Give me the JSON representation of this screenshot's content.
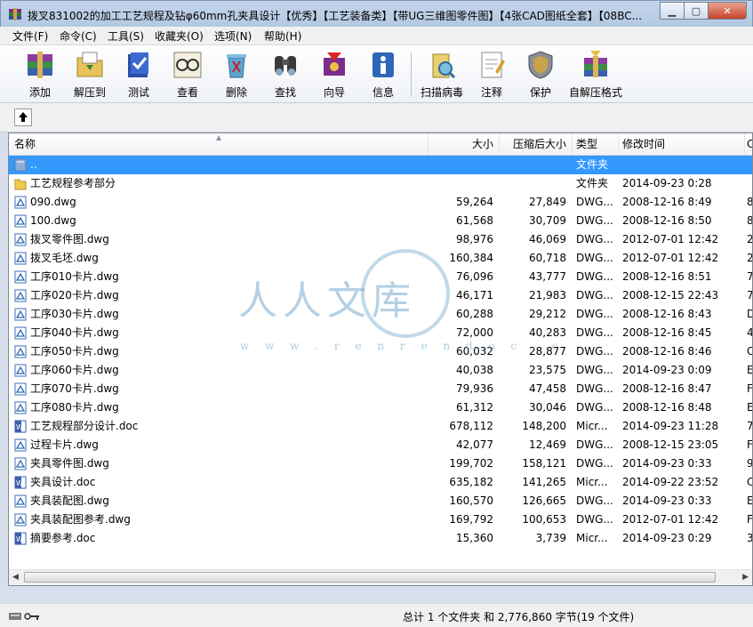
{
  "window": {
    "title": "拨叉831002的加工工艺规程及钻φ60mm孔夹具设计【优秀】【工艺装备类】【带UG三维图零件图】【4张CAD图纸全套】【08BC..."
  },
  "menu": [
    "文件(F)",
    "命令(C)",
    "工具(S)",
    "收藏夹(O)",
    "选项(N)",
    "帮助(H)"
  ],
  "toolbar": [
    {
      "label": "添加",
      "icon": "add-archive-icon"
    },
    {
      "label": "解压到",
      "icon": "extract-to-icon"
    },
    {
      "label": "测试",
      "icon": "test-icon"
    },
    {
      "label": "查看",
      "icon": "view-icon"
    },
    {
      "label": "删除",
      "icon": "delete-icon"
    },
    {
      "label": "查找",
      "icon": "find-icon"
    },
    {
      "label": "向导",
      "icon": "wizard-icon"
    },
    {
      "label": "信息",
      "icon": "info-icon"
    },
    {
      "label": "扫描病毒",
      "icon": "virus-scan-icon"
    },
    {
      "label": "注释",
      "icon": "comment-icon"
    },
    {
      "label": "保护",
      "icon": "protect-icon"
    },
    {
      "label": "自解压格式",
      "icon": "sfx-icon"
    }
  ],
  "columns": {
    "name": "名称",
    "size": "大小",
    "packed": "压缩后大小",
    "type": "类型",
    "modified": "修改时间",
    "crc": "C"
  },
  "files": [
    {
      "name": "..",
      "size": "",
      "packed": "",
      "type": "文件夹",
      "modified": "",
      "crc": "",
      "kind": "parent"
    },
    {
      "name": "工艺规程参考部分",
      "size": "",
      "packed": "",
      "type": "文件夹",
      "modified": "2014-09-23 0:28",
      "crc": "",
      "kind": "folder"
    },
    {
      "name": "090.dwg",
      "size": "59,264",
      "packed": "27,849",
      "type": "DWG...",
      "modified": "2008-12-16 8:49",
      "crc": "8",
      "kind": "dwg"
    },
    {
      "name": "100.dwg",
      "size": "61,568",
      "packed": "30,709",
      "type": "DWG...",
      "modified": "2008-12-16 8:50",
      "crc": "8",
      "kind": "dwg"
    },
    {
      "name": "拨叉零件图.dwg",
      "size": "98,976",
      "packed": "46,069",
      "type": "DWG...",
      "modified": "2012-07-01 12:42",
      "crc": "2",
      "kind": "dwg"
    },
    {
      "name": "拨叉毛坯.dwg",
      "size": "160,384",
      "packed": "60,718",
      "type": "DWG...",
      "modified": "2012-07-01 12:42",
      "crc": "2",
      "kind": "dwg"
    },
    {
      "name": "工序010卡片.dwg",
      "size": "76,096",
      "packed": "43,777",
      "type": "DWG...",
      "modified": "2008-12-16 8:51",
      "crc": "7",
      "kind": "dwg"
    },
    {
      "name": "工序020卡片.dwg",
      "size": "46,171",
      "packed": "21,983",
      "type": "DWG...",
      "modified": "2008-12-15 22:43",
      "crc": "7",
      "kind": "dwg"
    },
    {
      "name": "工序030卡片.dwg",
      "size": "60,288",
      "packed": "29,212",
      "type": "DWG...",
      "modified": "2008-12-16 8:43",
      "crc": "D",
      "kind": "dwg"
    },
    {
      "name": "工序040卡片.dwg",
      "size": "72,000",
      "packed": "40,283",
      "type": "DWG...",
      "modified": "2008-12-16 8:45",
      "crc": "4",
      "kind": "dwg"
    },
    {
      "name": "工序050卡片.dwg",
      "size": "60,032",
      "packed": "28,877",
      "type": "DWG...",
      "modified": "2008-12-16 8:46",
      "crc": "C",
      "kind": "dwg"
    },
    {
      "name": "工序060卡片.dwg",
      "size": "40,038",
      "packed": "23,575",
      "type": "DWG...",
      "modified": "2014-09-23 0:09",
      "crc": "E",
      "kind": "dwg"
    },
    {
      "name": "工序070卡片.dwg",
      "size": "79,936",
      "packed": "47,458",
      "type": "DWG...",
      "modified": "2008-12-16 8:47",
      "crc": "F",
      "kind": "dwg"
    },
    {
      "name": "工序080卡片.dwg",
      "size": "61,312",
      "packed": "30,046",
      "type": "DWG...",
      "modified": "2008-12-16 8:48",
      "crc": "E",
      "kind": "dwg"
    },
    {
      "name": "工艺规程部分设计.doc",
      "size": "678,112",
      "packed": "148,200",
      "type": "Micr...",
      "modified": "2014-09-23 11:28",
      "crc": "7",
      "kind": "doc"
    },
    {
      "name": "过程卡片.dwg",
      "size": "42,077",
      "packed": "12,469",
      "type": "DWG...",
      "modified": "2008-12-15 23:05",
      "crc": "F",
      "kind": "dwg"
    },
    {
      "name": "夹具零件图.dwg",
      "size": "199,702",
      "packed": "158,121",
      "type": "DWG...",
      "modified": "2014-09-23 0:33",
      "crc": "9",
      "kind": "dwg"
    },
    {
      "name": "夹具设计.doc",
      "size": "635,182",
      "packed": "141,265",
      "type": "Micr...",
      "modified": "2014-09-22 23:52",
      "crc": "C",
      "kind": "doc"
    },
    {
      "name": "夹具装配图.dwg",
      "size": "160,570",
      "packed": "126,665",
      "type": "DWG...",
      "modified": "2014-09-23 0:33",
      "crc": "E",
      "kind": "dwg"
    },
    {
      "name": "夹具装配图参考.dwg",
      "size": "169,792",
      "packed": "100,653",
      "type": "DWG...",
      "modified": "2012-07-01 12:42",
      "crc": "F",
      "kind": "dwg"
    },
    {
      "name": "摘要参考.doc",
      "size": "15,360",
      "packed": "3,739",
      "type": "Micr...",
      "modified": "2014-09-23 0:29",
      "crc": "3",
      "kind": "doc"
    }
  ],
  "status": {
    "text": "总计 1 个文件夹 和 2,776,860 字节(19 个文件)"
  },
  "watermark": {
    "text": "人人文库",
    "url": "w w w . r e n r e n d o c . c"
  },
  "colors": {
    "selection": "#3399ff",
    "titlebar": "#b9cce4",
    "close": "#c7442c"
  }
}
